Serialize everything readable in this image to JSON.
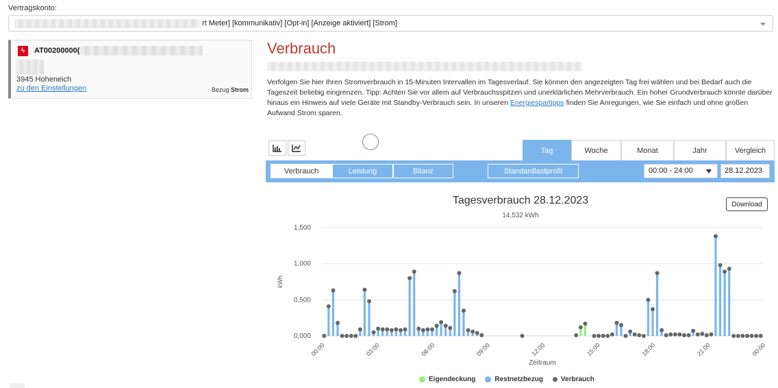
{
  "account": {
    "label": "Vertragskonto:",
    "selected_value": "rt Meter] [kommunikativ] [Opt-in] [Anzeige aktiviert] [Strom]"
  },
  "meter_card": {
    "id": "AT00200000(",
    "city": "3945 Hoheneich",
    "settings_link": "zu den Einstellungen",
    "bezug_label": "Bezug",
    "bezug_type": "Strom",
    "accent_color": "#e2001a"
  },
  "page": {
    "title": "Verbrauch",
    "intro_before_link": "Verfolgen Sie hier Ihren Stromverbrauch in 15-Minuten Intervallen im Tagesverlauf. Sie können den angezeigten Tag frei wählen und bei Bedarf auch die Tageszeit beliebig eingrenzen. Tipp: Achten Sie vor allem auf Verbrauchsspitzen und unerklärlichen Mehrverbrauch. Ein hoher Grundverbrauch könnte darüber hinaus ein Hinweis auf viele Geräte mit Standby-Verbrauch sein. In unseren ",
    "intro_link": "Energiespartipps",
    "intro_after_link": " finden Sie Anregungen, wie Sie einfach und ohne großen Aufwand Strom sparen."
  },
  "chart_type_buttons": [
    {
      "icon": "bar-chart-icon"
    },
    {
      "icon": "line-chart-icon"
    }
  ],
  "period_tabs": [
    {
      "label": "Tag",
      "active": true
    },
    {
      "label": "Woche",
      "active": false
    },
    {
      "label": "Monat",
      "active": false
    },
    {
      "label": "Jahr",
      "active": false
    },
    {
      "label": "Vergleich",
      "active": false
    }
  ],
  "toolbar": {
    "segments": [
      {
        "label": "Verbrauch",
        "active": true
      },
      {
        "label": "Leistung",
        "active": false
      },
      {
        "label": "Bilanz",
        "active": false
      }
    ],
    "standard_profile_label": "Standardlastprofil",
    "time_range": "00:00 - 24:00",
    "date": "28.12.2023",
    "bar_color": "#7cb5ec"
  },
  "download_label": "Download",
  "chart_data": {
    "type": "bar",
    "title": "Tagesverbrauch 28.12.2023",
    "subtitle": "14,532 kWh",
    "xlabel": "Zeitraum",
    "ylabel": "kWh",
    "ylim": [
      0,
      1.5
    ],
    "y_ticks": [
      "0,000",
      "0,500",
      "1,000",
      "1,500"
    ],
    "x_ticks": [
      "00:00",
      "03:00",
      "06:00",
      "09:00",
      "12:00",
      "15:00",
      "18:00",
      "21:00",
      "00:00"
    ],
    "interval_minutes": 15,
    "grid": true,
    "legend_position": "bottom",
    "series": [
      {
        "name": "Eigendeckung",
        "color": "#90ed7d"
      },
      {
        "name": "Restnetzbezug",
        "color": "#7cb5ec"
      },
      {
        "name": "Verbrauch",
        "color": "#666666"
      }
    ],
    "values": [
      0.0,
      0.41,
      0.63,
      0.18,
      0.0,
      0.0,
      0.0,
      0.0,
      0.09,
      0.64,
      0.48,
      0.05,
      0.1,
      0.09,
      0.09,
      0.08,
      0.09,
      0.08,
      0.09,
      0.8,
      0.89,
      0.1,
      0.08,
      0.09,
      0.09,
      0.14,
      0.19,
      0.14,
      0.11,
      0.62,
      0.87,
      0.35,
      0.08,
      0.06,
      0.04,
      0.01,
      null,
      null,
      null,
      null,
      null,
      null,
      null,
      null,
      0.0,
      null,
      null,
      null,
      null,
      null,
      null,
      null,
      null,
      null,
      null,
      null,
      0.01,
      0.12,
      0.17,
      null,
      0.0,
      0.0,
      0.0,
      0.0,
      0.02,
      0.18,
      0.15,
      0.0,
      0.06,
      0.02,
      0.01,
      0.0,
      0.5,
      0.37,
      0.87,
      0.08,
      0.01,
      0.02,
      0.02,
      0.02,
      0.01,
      0.01,
      0.07,
      0.02,
      0.03,
      0.01,
      0.02,
      1.38,
      0.98,
      0.89,
      0.93,
      0.0,
      0.0,
      0.0,
      0.0,
      0.0,
      0.0,
      0.0
    ],
    "eigendeckung_values": [
      0,
      0,
      0,
      0,
      0,
      0,
      0,
      0,
      0,
      0,
      0,
      0,
      0,
      0,
      0,
      0,
      0,
      0,
      0,
      0,
      0,
      0,
      0,
      0,
      0,
      0,
      0,
      0,
      0,
      0,
      0,
      0,
      0,
      0,
      0,
      0,
      0,
      0,
      0,
      0,
      0,
      0,
      0,
      0,
      0,
      0,
      0,
      0,
      0,
      0,
      0,
      0,
      0,
      0,
      0,
      0,
      0,
      0.12,
      0.17,
      0,
      0,
      0,
      0,
      0,
      0,
      0,
      0,
      0,
      0,
      0,
      0,
      0,
      0,
      0,
      0,
      0,
      0,
      0,
      0,
      0,
      0,
      0,
      0,
      0,
      0,
      0,
      0,
      0,
      0,
      0,
      0,
      0,
      0,
      0,
      0,
      0,
      0,
      0
    ]
  }
}
